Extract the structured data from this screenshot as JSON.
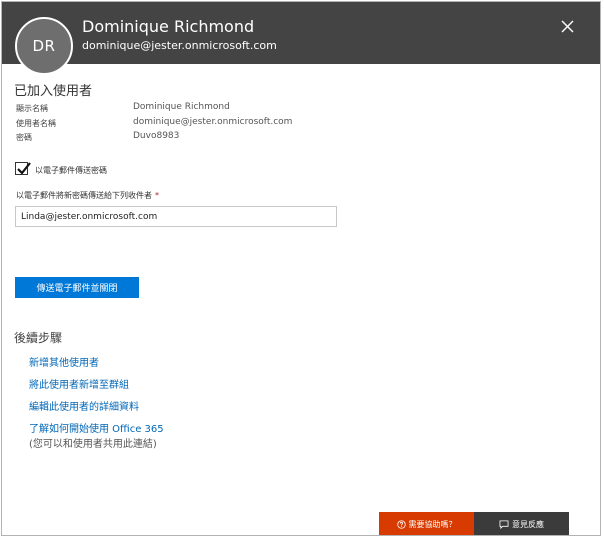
{
  "header": {
    "avatar_initials": "DR",
    "user_name": "Dominique Richmond",
    "user_email": "dominique@jester.onmicrosoft.com",
    "close_icon": "close-icon"
  },
  "added_user": {
    "title": "已加入使用者",
    "rows": [
      {
        "label": "顯示名稱",
        "value": "Dominique Richmond"
      },
      {
        "label": "使用者名稱",
        "value": "dominique@jester.onmicrosoft.com"
      },
      {
        "label": "密碼",
        "value": "Duvo8983"
      }
    ]
  },
  "email_password": {
    "checkbox_label": "以電子郵件傳送密碼",
    "checked": true,
    "field_label": "以電子郵件將新密碼傳送給下列收件者",
    "required_marker": "*",
    "input_value": "Linda@jester.onmicrosoft.com",
    "send_button_label": "傳送電子郵件並關閉"
  },
  "next_steps": {
    "title": "後續步驟",
    "links": [
      "新增其他使用者",
      "將此使用者新增至群組",
      "編輯此使用者的詳細資料",
      "了解如何開始使用 Office 365"
    ],
    "note": "(您可以和使用者共用此連結)"
  },
  "footer": {
    "help_label": "需要協助嗎？",
    "help_icon": "question-circle-icon",
    "feedback_label": "意見反應",
    "feedback_icon": "comment-icon"
  },
  "colors": {
    "header_bg": "#444444",
    "primary_button": "#0078d7",
    "link": "#0067b8",
    "help_button": "#d83b01",
    "feedback_button": "#3b3b3b"
  }
}
